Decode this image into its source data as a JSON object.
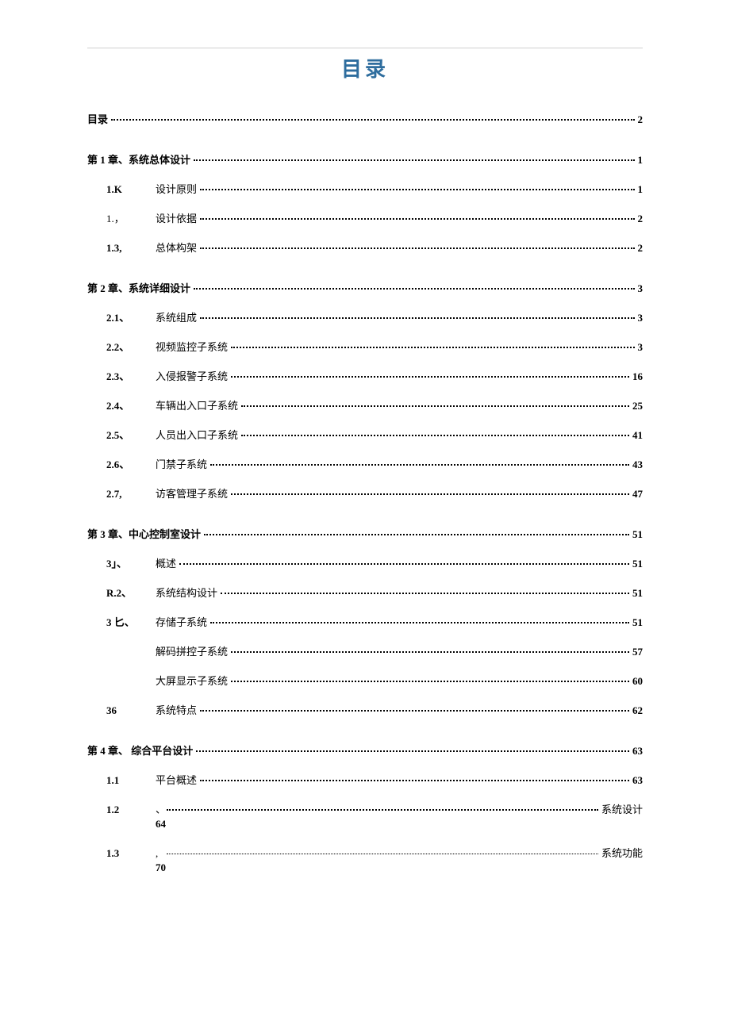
{
  "title": "目录",
  "entries": [
    {
      "type": "row1",
      "label": "目录",
      "page": "2"
    },
    {
      "type": "row1",
      "label": "第 1 章、系统总体设计",
      "page": "1"
    },
    {
      "type": "row2",
      "num": "1.K",
      "label": "设计原则",
      "page": "1"
    },
    {
      "type": "row2",
      "num": "1.，",
      "numLight": true,
      "label": "设计依据",
      "page": "2"
    },
    {
      "type": "row2",
      "num": "1.3,",
      "label": "总体构架",
      "page": "2"
    },
    {
      "type": "row1",
      "label": "第 2 章、系统详细设计",
      "page": "3"
    },
    {
      "type": "row2",
      "num": "2.1、",
      "label": "系统组成",
      "page": "3"
    },
    {
      "type": "row2",
      "num": "2.2、",
      "label": "视频监控子系统",
      "page": "3"
    },
    {
      "type": "row2",
      "num": "2.3、",
      "label": "入侵报警子系统",
      "page": "16"
    },
    {
      "type": "row2",
      "num": "2.4、",
      "label": "车辆出入口子系统",
      "page": "25"
    },
    {
      "type": "row2",
      "num": "2.5、",
      "label": "人员出入口子系统",
      "page": "41"
    },
    {
      "type": "row2",
      "num": "2.6、",
      "label": "门禁子系统",
      "page": "43"
    },
    {
      "type": "row2",
      "num": "2.7,",
      "label": "访客管理子系统",
      "page": "47"
    },
    {
      "type": "row1",
      "label": "第 3 章、中心控制室设计",
      "page": "51"
    },
    {
      "type": "row2",
      "num": "3」、",
      "label": "概述",
      "page": "51"
    },
    {
      "type": "row2",
      "num": "R.2、",
      "label": "系统结构设计",
      "page": "51"
    },
    {
      "type": "row2",
      "num": "3 匕、",
      "label": "存储子系统",
      "page": "51"
    },
    {
      "type": "row2",
      "num": "",
      "label": "解码拼控子系统",
      "page": "57"
    },
    {
      "type": "row2",
      "num": "",
      "label": "大屏显示子系统",
      "page": "60"
    },
    {
      "type": "row2",
      "num": "36",
      "label": "系统特点",
      "page": "62"
    },
    {
      "type": "row1-indent",
      "label": "第 4 章、   综合平台设计",
      "page": "63"
    },
    {
      "type": "row2",
      "num": "1.1",
      "label": "平台概述",
      "page": "63"
    },
    {
      "type": "row2-tail",
      "num": "1.2",
      "pre": "、",
      "tail": "系统设计",
      "page": "64"
    },
    {
      "type": "row2-tail-thin",
      "num": "1.3",
      "pre": ",",
      "tail": "系统功能",
      "page": "70"
    }
  ]
}
